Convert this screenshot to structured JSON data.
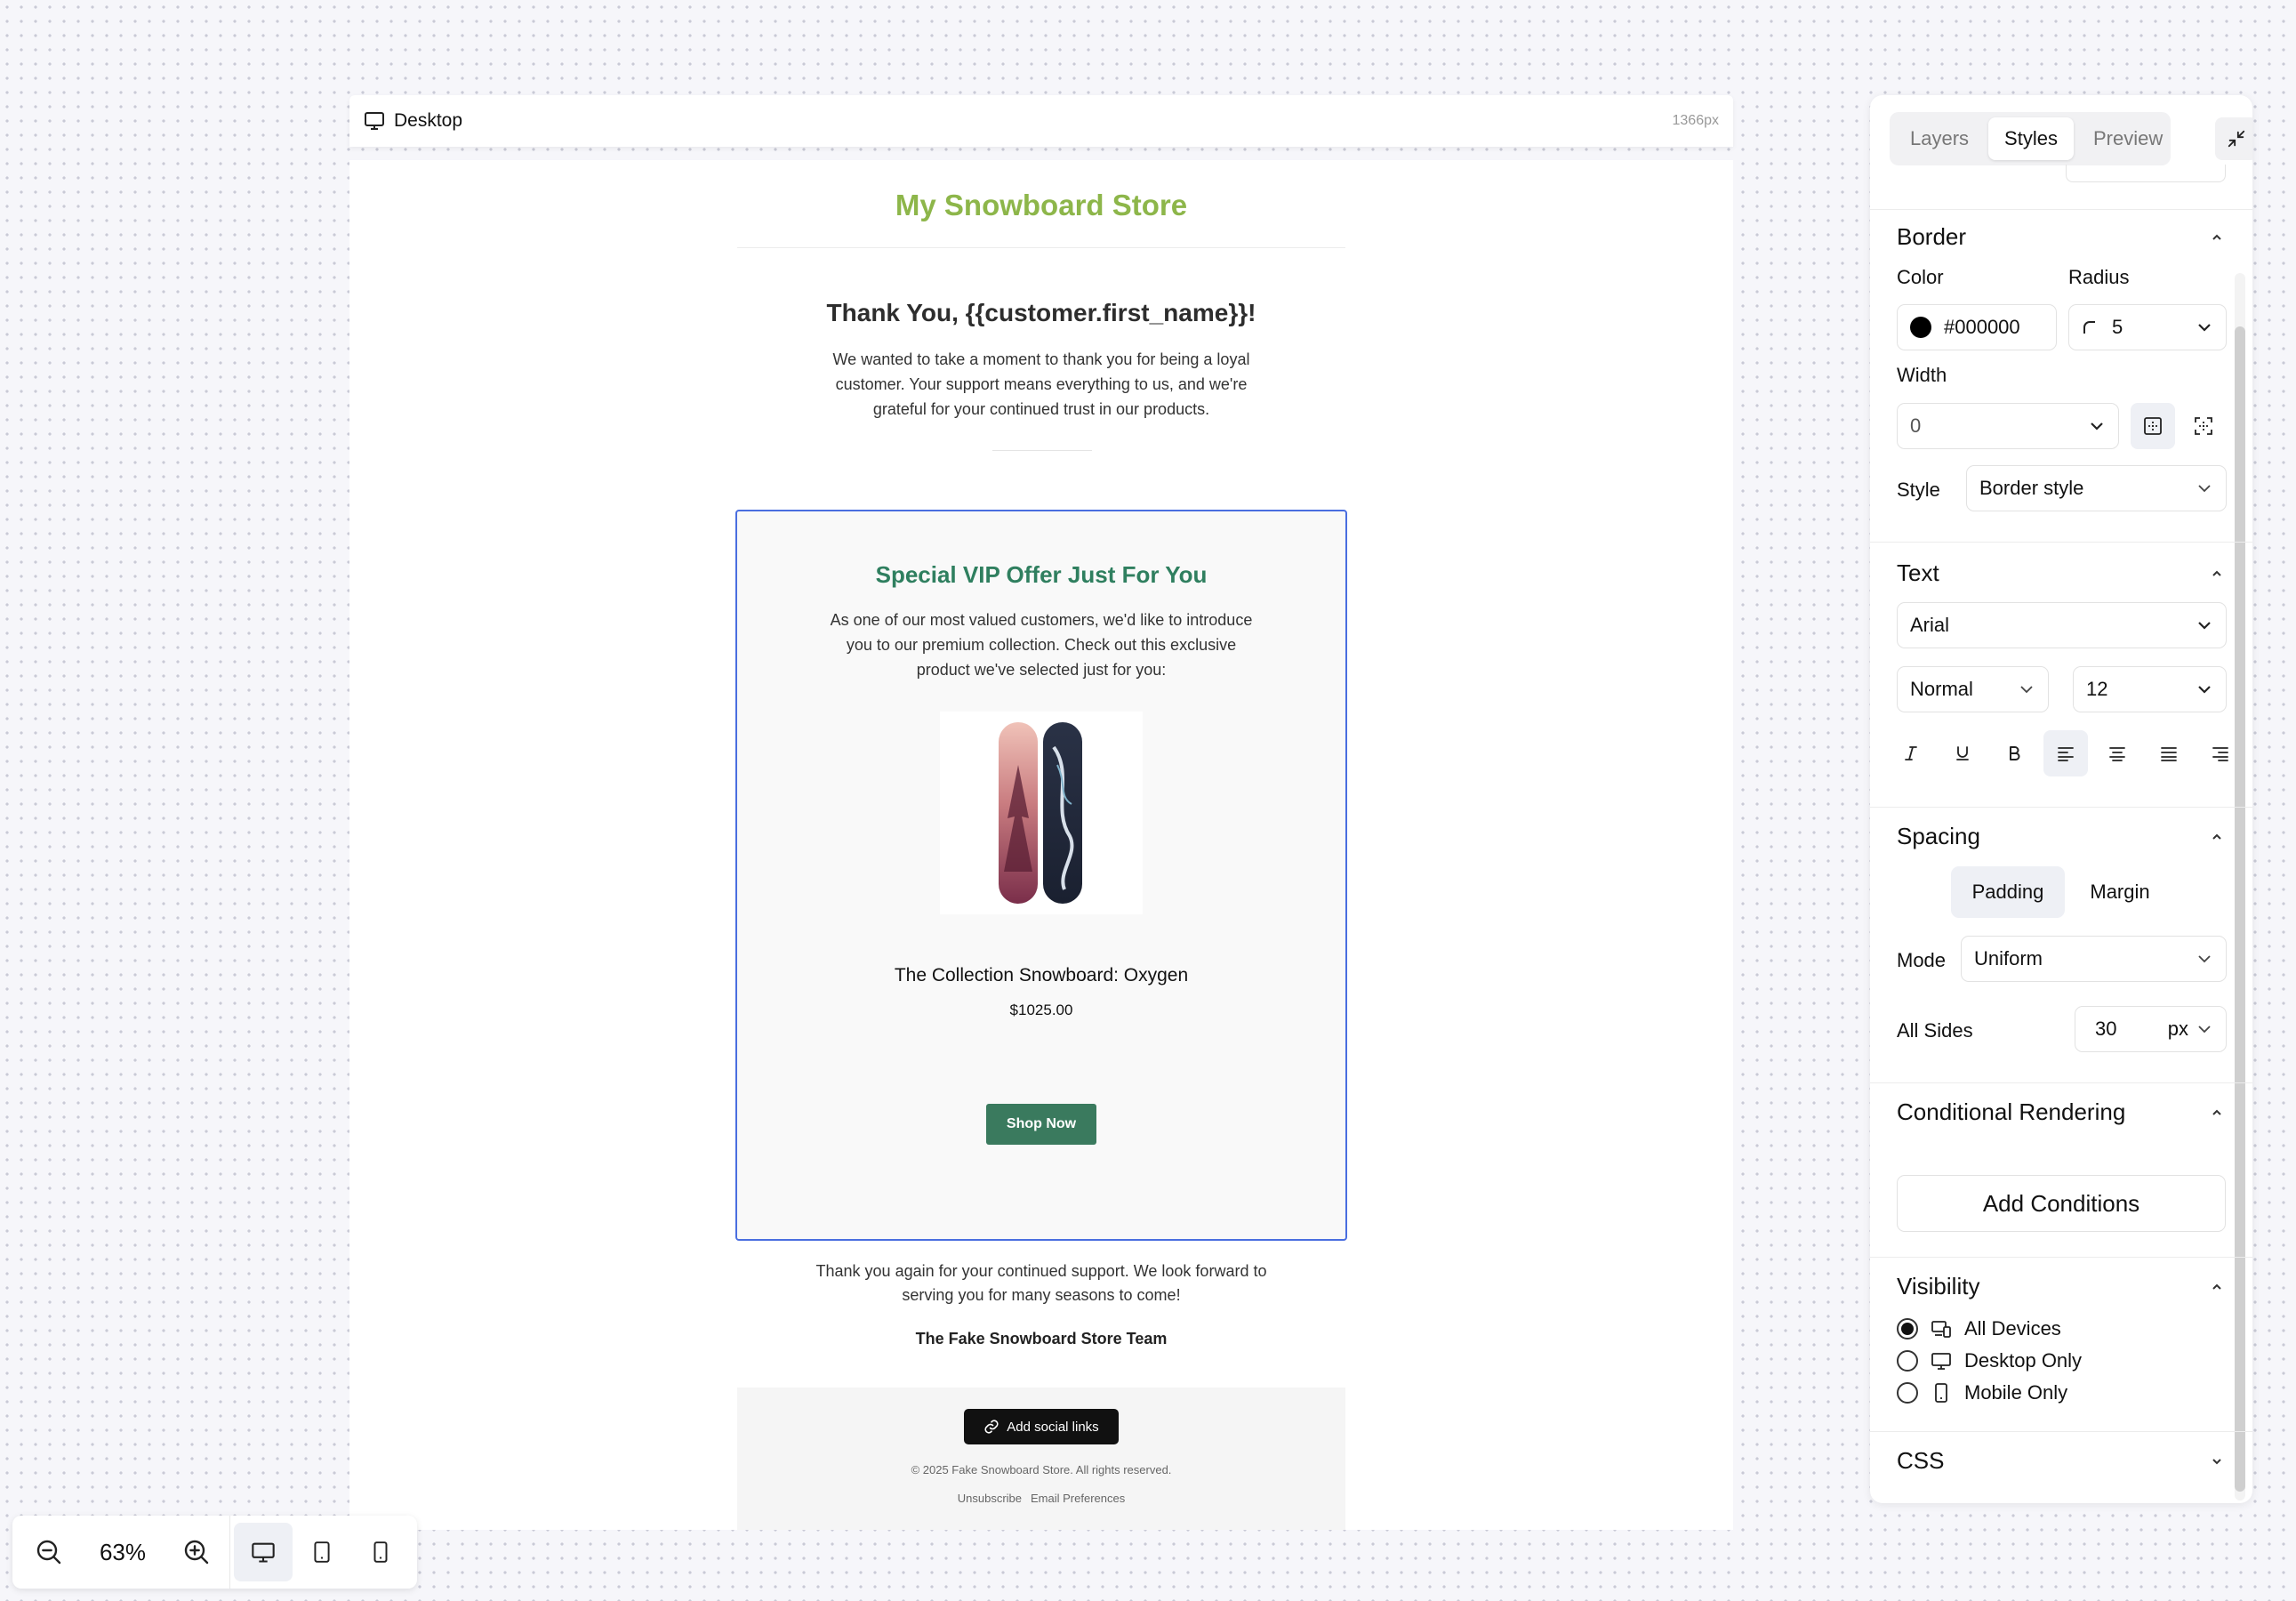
{
  "canvas": {
    "device_label": "Desktop",
    "width_label": "1366px"
  },
  "email": {
    "store_name": "My Snowboard Store",
    "greeting_title": "Thank You, {{customer.first_name}}!",
    "greeting_body": "We wanted to take a moment to thank you for being a loyal customer. Your support means everything to us, and we're grateful for your continued trust in our products.",
    "vip_title": "Special VIP Offer Just For You",
    "vip_body": "As one of our most valued customers, we'd like to introduce you to our premium collection. Check out this exclusive product we've selected just for you:",
    "product_name": "The Collection Snowboard: Oxygen",
    "product_price": "$1025.00",
    "shop_button": "Shop Now",
    "closing": "Thank you again for your continued support. We look forward to serving you for many seasons to come!",
    "signature": "The Fake Snowboard Store Team",
    "social_button": "Add social links",
    "copyright": "© 2025 Fake Snowboard Store. All rights reserved.",
    "unsubscribe": "Unsubscribe",
    "preferences": "Email Preferences",
    "colors": {
      "brand_green": "#8db64a",
      "vip_green": "#2f7f5f",
      "button_green": "#3a7a5e",
      "selection_blue": "#4a6ee0"
    }
  },
  "panel": {
    "tabs": [
      "Layers",
      "Styles",
      "Preview"
    ],
    "active_tab": "Styles",
    "border": {
      "title": "Border",
      "color_label": "Color",
      "color_value": "#000000",
      "radius_label": "Radius",
      "radius_value": "5",
      "width_label": "Width",
      "width_value": "0",
      "style_label": "Style",
      "style_value": "Border style"
    },
    "text": {
      "title": "Text",
      "font": "Arial",
      "weight": "Normal",
      "size": "12"
    },
    "spacing": {
      "title": "Spacing",
      "padding_label": "Padding",
      "margin_label": "Margin",
      "mode_label": "Mode",
      "mode_value": "Uniform",
      "all_sides_label": "All Sides",
      "all_sides_value": "30",
      "unit": "px"
    },
    "conditional": {
      "title": "Conditional Rendering",
      "add_button": "Add Conditions"
    },
    "visibility": {
      "title": "Visibility",
      "options": [
        "All Devices",
        "Desktop Only",
        "Mobile Only"
      ],
      "selected": "All Devices"
    },
    "css": {
      "title": "CSS"
    }
  },
  "zoom": {
    "value": "63%"
  }
}
